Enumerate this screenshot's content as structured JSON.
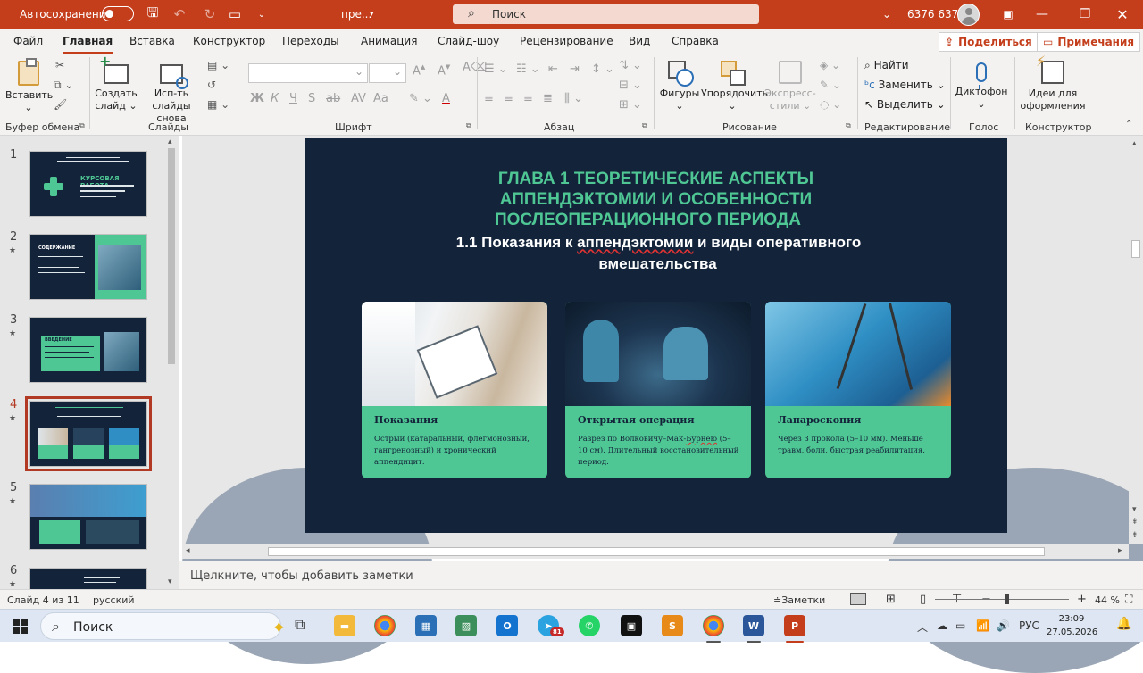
{
  "titlebar": {
    "autosave_label": "Автосохранение",
    "doc_name": "пре...",
    "search_placeholder": "Поиск",
    "user_name": "6376 6376"
  },
  "tabs": [
    "Файл",
    "Главная",
    "Вставка",
    "Конструктор",
    "Переходы",
    "Анимация",
    "Слайд-шоу",
    "Рецензирование",
    "Вид",
    "Справка"
  ],
  "active_tab": "Главная",
  "header_buttons": {
    "share": "Поделиться",
    "comments": "Примечания"
  },
  "ribbon": {
    "paste": "Вставить",
    "new_slide_1": "Создать",
    "new_slide_2": "слайд",
    "reuse_1": "Исп-ть",
    "reuse_2": "слайды снова",
    "shapes": "Фигуры",
    "arrange": "Упорядочить",
    "styles_1": "Экспресс-",
    "styles_2": "стили",
    "find": "Найти",
    "replace": "Заменить",
    "select": "Выделить",
    "dictate": "Диктофон",
    "designer_1": "Идеи для",
    "designer_2": "оформления",
    "groups": {
      "clipboard": "Буфер обмена",
      "slides": "Слайды",
      "font": "Шрифт",
      "paragraph": "Абзац",
      "drawing": "Рисование",
      "editing": "Редактирование",
      "voice": "Голос",
      "designer": "Конструктор"
    },
    "font_buttons": [
      "Ж",
      "К",
      "Ч",
      "S",
      "ab",
      "AV",
      "Aa",
      "A"
    ]
  },
  "thumbnails": [
    {
      "num": "1",
      "star": false
    },
    {
      "num": "2",
      "star": true
    },
    {
      "num": "3",
      "star": true
    },
    {
      "num": "4",
      "star": true
    },
    {
      "num": "5",
      "star": true
    },
    {
      "num": "6",
      "star": true
    }
  ],
  "thumb_texts": {
    "t1": "КУРСОВАЯ РАБОТА",
    "t2": "СОДЕРЖАНИЕ",
    "t3": "ВВЕДЕНИЕ"
  },
  "slide": {
    "title_line1": "ГЛАВА 1 ТЕОРЕТИЧЕСКИЕ АСПЕКТЫ",
    "title_line2": "АППЕНДЭКТОМИИ И ОСОБЕННОСТИ",
    "title_line3": "ПОСЛЕОПЕРАЦИОННОГО ПЕРИОДА",
    "sub_a": "1.1 Показания к ",
    "sub_b": "аппендэктомии",
    "sub_c": " и виды оперативного",
    "sub_line2": "вмешательства",
    "cards": [
      {
        "title": "Показания",
        "text": "Острый (катаральный, флегмонозный, гангренозный) и хронический аппендицит."
      },
      {
        "title": "Открытая операция",
        "text_a": "Разрез по Волковичу–Мак-",
        "text_b": "Бурнею",
        "text_c": " (5–10 см). Длительный восстановительный период."
      },
      {
        "title": "Лапароскопия",
        "text": "Через 3 прокола (5–10 мм). Меньше травм, боли, быстрая реабилитация."
      }
    ]
  },
  "notes_placeholder": "Щелкните, чтобы добавить заметки",
  "status": {
    "slide_counter": "Слайд 4 из 11",
    "language": "русский",
    "notes_btn": "Заметки",
    "zoom": "44 %",
    "zoom_level": 44
  },
  "taskbar": {
    "search": "Поиск",
    "tg_badge": "81",
    "lang": "РУС",
    "time": "23:09",
    "date": "27.05.2026"
  },
  "colors": {
    "accent": "#c43e1c",
    "slide_bg": "#13233a",
    "slide_green": "#4fc794"
  }
}
